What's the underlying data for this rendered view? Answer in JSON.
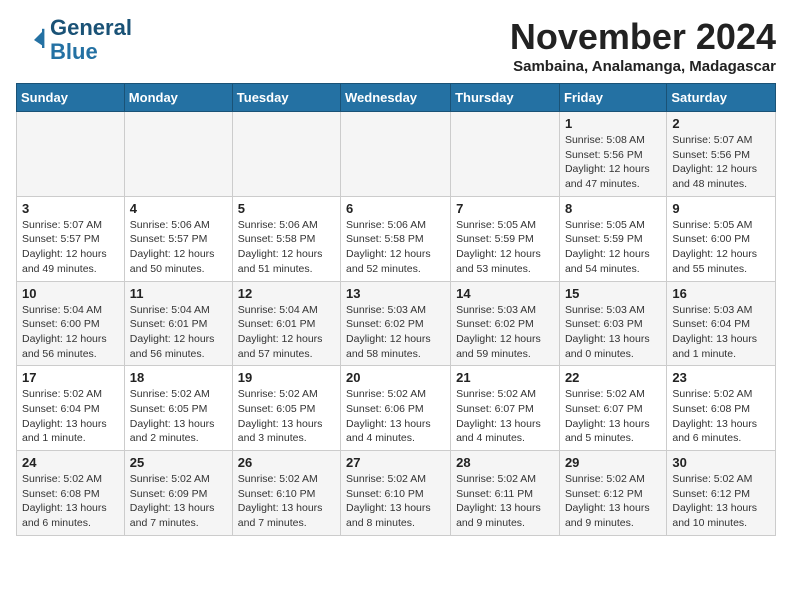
{
  "header": {
    "logo_line1": "General",
    "logo_line2": "Blue",
    "month_title": "November 2024",
    "location": "Sambaina, Analamanga, Madagascar"
  },
  "weekdays": [
    "Sunday",
    "Monday",
    "Tuesday",
    "Wednesday",
    "Thursday",
    "Friday",
    "Saturday"
  ],
  "weeks": [
    [
      {
        "day": "",
        "info": ""
      },
      {
        "day": "",
        "info": ""
      },
      {
        "day": "",
        "info": ""
      },
      {
        "day": "",
        "info": ""
      },
      {
        "day": "",
        "info": ""
      },
      {
        "day": "1",
        "info": "Sunrise: 5:08 AM\nSunset: 5:56 PM\nDaylight: 12 hours\nand 47 minutes."
      },
      {
        "day": "2",
        "info": "Sunrise: 5:07 AM\nSunset: 5:56 PM\nDaylight: 12 hours\nand 48 minutes."
      }
    ],
    [
      {
        "day": "3",
        "info": "Sunrise: 5:07 AM\nSunset: 5:57 PM\nDaylight: 12 hours\nand 49 minutes."
      },
      {
        "day": "4",
        "info": "Sunrise: 5:06 AM\nSunset: 5:57 PM\nDaylight: 12 hours\nand 50 minutes."
      },
      {
        "day": "5",
        "info": "Sunrise: 5:06 AM\nSunset: 5:58 PM\nDaylight: 12 hours\nand 51 minutes."
      },
      {
        "day": "6",
        "info": "Sunrise: 5:06 AM\nSunset: 5:58 PM\nDaylight: 12 hours\nand 52 minutes."
      },
      {
        "day": "7",
        "info": "Sunrise: 5:05 AM\nSunset: 5:59 PM\nDaylight: 12 hours\nand 53 minutes."
      },
      {
        "day": "8",
        "info": "Sunrise: 5:05 AM\nSunset: 5:59 PM\nDaylight: 12 hours\nand 54 minutes."
      },
      {
        "day": "9",
        "info": "Sunrise: 5:05 AM\nSunset: 6:00 PM\nDaylight: 12 hours\nand 55 minutes."
      }
    ],
    [
      {
        "day": "10",
        "info": "Sunrise: 5:04 AM\nSunset: 6:00 PM\nDaylight: 12 hours\nand 56 minutes."
      },
      {
        "day": "11",
        "info": "Sunrise: 5:04 AM\nSunset: 6:01 PM\nDaylight: 12 hours\nand 56 minutes."
      },
      {
        "day": "12",
        "info": "Sunrise: 5:04 AM\nSunset: 6:01 PM\nDaylight: 12 hours\nand 57 minutes."
      },
      {
        "day": "13",
        "info": "Sunrise: 5:03 AM\nSunset: 6:02 PM\nDaylight: 12 hours\nand 58 minutes."
      },
      {
        "day": "14",
        "info": "Sunrise: 5:03 AM\nSunset: 6:02 PM\nDaylight: 12 hours\nand 59 minutes."
      },
      {
        "day": "15",
        "info": "Sunrise: 5:03 AM\nSunset: 6:03 PM\nDaylight: 13 hours\nand 0 minutes."
      },
      {
        "day": "16",
        "info": "Sunrise: 5:03 AM\nSunset: 6:04 PM\nDaylight: 13 hours\nand 1 minute."
      }
    ],
    [
      {
        "day": "17",
        "info": "Sunrise: 5:02 AM\nSunset: 6:04 PM\nDaylight: 13 hours\nand 1 minute."
      },
      {
        "day": "18",
        "info": "Sunrise: 5:02 AM\nSunset: 6:05 PM\nDaylight: 13 hours\nand 2 minutes."
      },
      {
        "day": "19",
        "info": "Sunrise: 5:02 AM\nSunset: 6:05 PM\nDaylight: 13 hours\nand 3 minutes."
      },
      {
        "day": "20",
        "info": "Sunrise: 5:02 AM\nSunset: 6:06 PM\nDaylight: 13 hours\nand 4 minutes."
      },
      {
        "day": "21",
        "info": "Sunrise: 5:02 AM\nSunset: 6:07 PM\nDaylight: 13 hours\nand 4 minutes."
      },
      {
        "day": "22",
        "info": "Sunrise: 5:02 AM\nSunset: 6:07 PM\nDaylight: 13 hours\nand 5 minutes."
      },
      {
        "day": "23",
        "info": "Sunrise: 5:02 AM\nSunset: 6:08 PM\nDaylight: 13 hours\nand 6 minutes."
      }
    ],
    [
      {
        "day": "24",
        "info": "Sunrise: 5:02 AM\nSunset: 6:08 PM\nDaylight: 13 hours\nand 6 minutes."
      },
      {
        "day": "25",
        "info": "Sunrise: 5:02 AM\nSunset: 6:09 PM\nDaylight: 13 hours\nand 7 minutes."
      },
      {
        "day": "26",
        "info": "Sunrise: 5:02 AM\nSunset: 6:10 PM\nDaylight: 13 hours\nand 7 minutes."
      },
      {
        "day": "27",
        "info": "Sunrise: 5:02 AM\nSunset: 6:10 PM\nDaylight: 13 hours\nand 8 minutes."
      },
      {
        "day": "28",
        "info": "Sunrise: 5:02 AM\nSunset: 6:11 PM\nDaylight: 13 hours\nand 9 minutes."
      },
      {
        "day": "29",
        "info": "Sunrise: 5:02 AM\nSunset: 6:12 PM\nDaylight: 13 hours\nand 9 minutes."
      },
      {
        "day": "30",
        "info": "Sunrise: 5:02 AM\nSunset: 6:12 PM\nDaylight: 13 hours\nand 10 minutes."
      }
    ]
  ]
}
